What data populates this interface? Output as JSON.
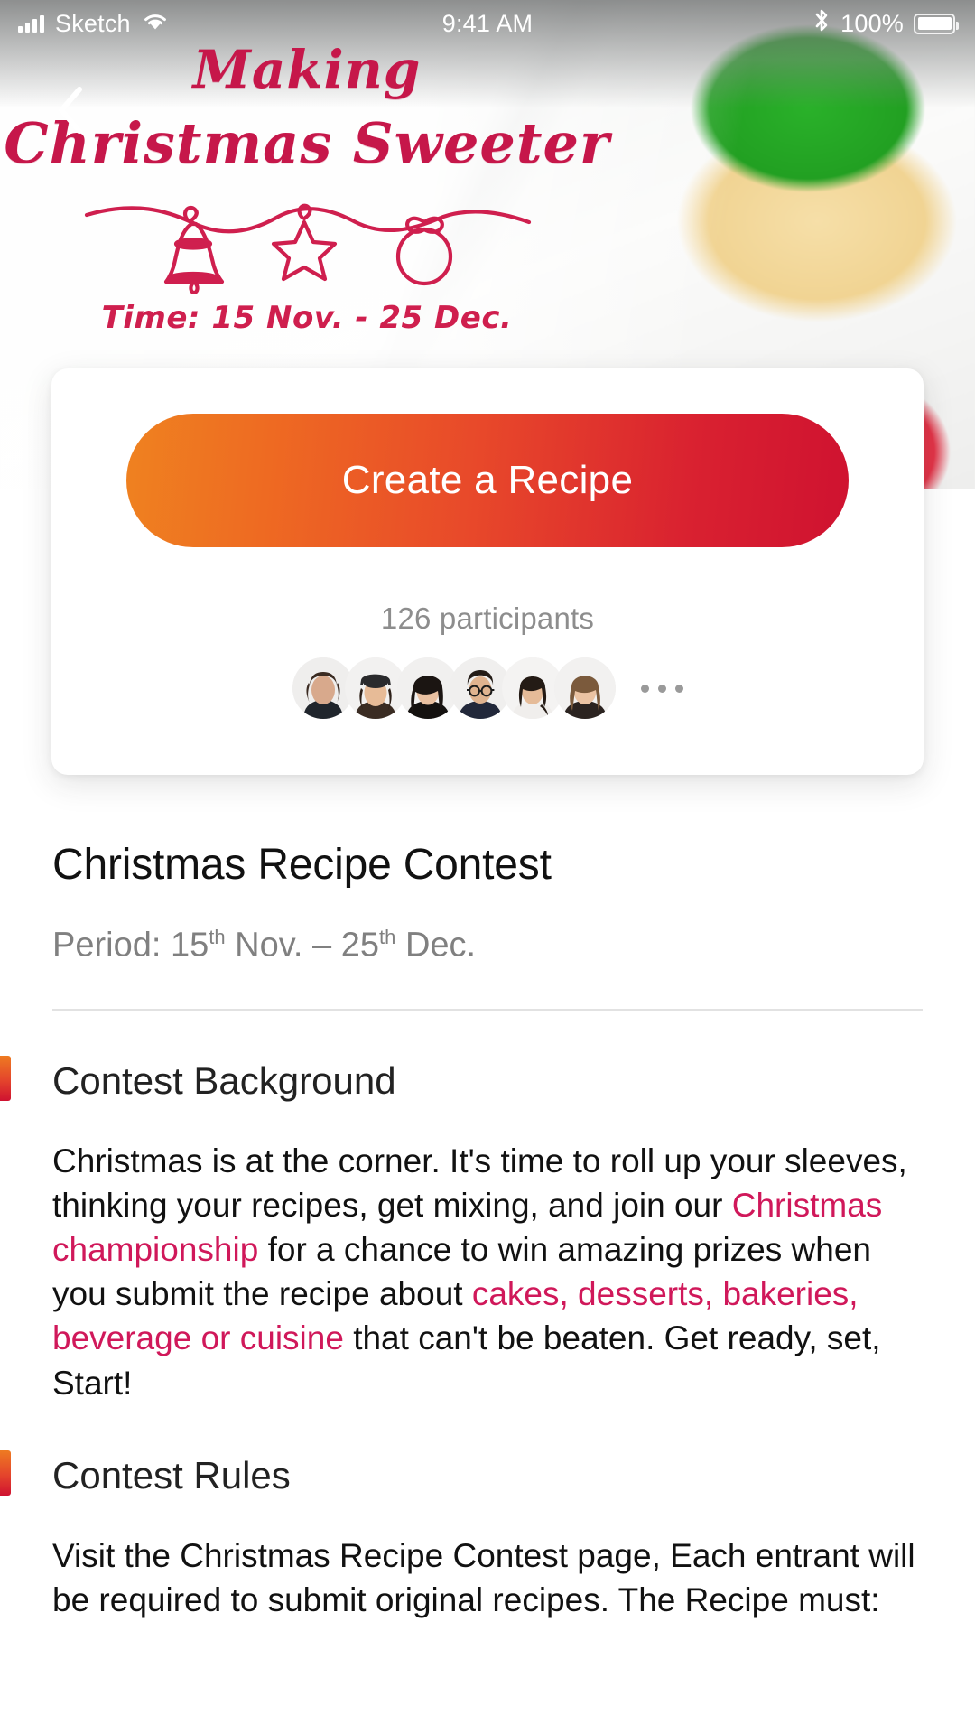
{
  "statusbar": {
    "carrier": "Sketch",
    "time": "9:41 AM",
    "battery_pct": "100%",
    "signal_icon": "signal-bars-icon",
    "wifi_icon": "wifi-icon",
    "bluetooth_icon": "bluetooth-icon",
    "battery_icon": "battery-full-icon"
  },
  "hero": {
    "back_icon": "chevron-left-icon",
    "title_line1": "Making",
    "title_line2": "Christmas Sweeter",
    "garland_icon": "christmas-garland-icon",
    "time_label": "Time: 15 Nov. - 25 Dec."
  },
  "card": {
    "cta_label": "Create a Recipe",
    "participants_label": "126 participants",
    "participant_count": 126,
    "avatars": [
      {
        "name": "participant-1",
        "hair": "#3b2b22",
        "skin": "#d8a98c",
        "shirt": "#20252c"
      },
      {
        "name": "participant-2",
        "hair": "#2e2119",
        "skin": "#e7bb97",
        "shirt": "#3a2c23",
        "hat": "#2a2a2c"
      },
      {
        "name": "participant-3",
        "hair": "#1b1512",
        "skin": "#e9c0a0",
        "shirt": "#14110f"
      },
      {
        "name": "participant-4",
        "hair": "#241c17",
        "skin": "#e0b38f",
        "shirt": "#22283a",
        "glasses": true
      },
      {
        "name": "participant-5",
        "hair": "#241b15",
        "skin": "#e5bb98",
        "shirt": "#f0eeec"
      },
      {
        "name": "participant-6",
        "hair": "#7b5a3c",
        "skin": "#ebc3a3",
        "shirt": "#2b2320"
      }
    ],
    "more_icon": "more-horizontal-icon"
  },
  "main": {
    "page_title": "Christmas Recipe Contest",
    "period": {
      "prefix": "Period: ",
      "start_day": "15",
      "start_sup": "th",
      "start_month": " Nov. ",
      "dash": "– ",
      "end_day": "25",
      "end_sup": "th",
      "end_month": " Dec."
    },
    "sections": [
      {
        "id": "contest-background",
        "title": "Contest Background",
        "parts": [
          {
            "text": "Christmas is at the corner. It's time to roll up your sleeves, thinking your recipes, get mixing, and join our ",
            "highlight": false
          },
          {
            "text": "Christmas championship",
            "highlight": true
          },
          {
            "text": " for a chance to win amazing prizes when you submit the recipe about ",
            "highlight": false
          },
          {
            "text": "cakes, desserts, bakeries, beverage or cuisine",
            "highlight": true
          },
          {
            "text": " that can't be beaten. Get ready, set, Start!",
            "highlight": false
          }
        ]
      },
      {
        "id": "contest-rules",
        "title": "Contest Rules",
        "parts": [
          {
            "text": "Visit the Christmas Recipe Contest page, Each entrant will be required to submit original recipes. The Recipe must:",
            "highlight": false
          }
        ]
      }
    ]
  },
  "colors": {
    "brand_crimson": "#c6174a",
    "highlight_pink": "#d0185a",
    "cta_gradient_start": "#ef8220",
    "cta_gradient_end": "#cf1230",
    "muted_text": "#808080"
  }
}
